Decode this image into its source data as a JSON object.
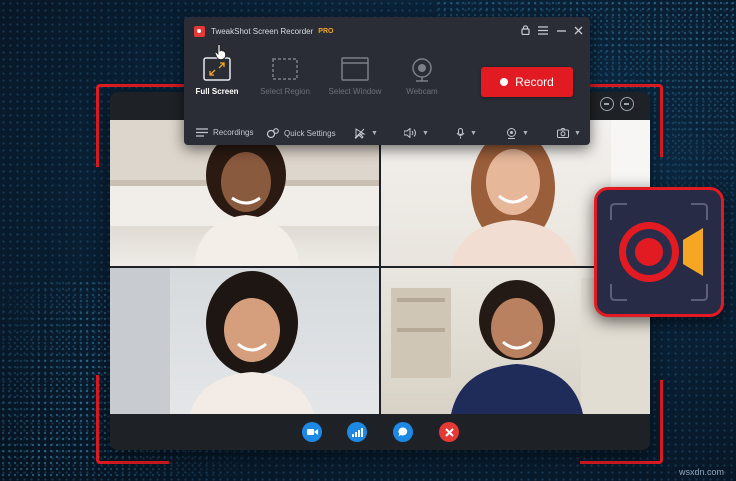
{
  "recorder": {
    "title": "TweakShot Screen Recorder",
    "badge": "PRO",
    "modes": [
      {
        "label": "Full Screen",
        "icon": "full-screen-icon",
        "active": true
      },
      {
        "label": "Select Region",
        "icon": "select-region-icon",
        "active": false
      },
      {
        "label": "Select Window",
        "icon": "select-window-icon",
        "active": false
      },
      {
        "label": "Webcam",
        "icon": "webcam-icon",
        "active": false
      }
    ],
    "record_label": "Record",
    "footer": {
      "recordings_label": "Recordings",
      "quick_settings_label": "Quick Settings"
    }
  },
  "call": {
    "controls": [
      "video-icon",
      "signal-icon",
      "chat-icon",
      "end-call-icon"
    ]
  },
  "watermark": "wsxdn.com",
  "colors": {
    "accent_red": "#e21b23",
    "call_blue": "#1e88e5",
    "toolbar_bg": "#2a2d35",
    "pro_orange": "#f5a623"
  }
}
